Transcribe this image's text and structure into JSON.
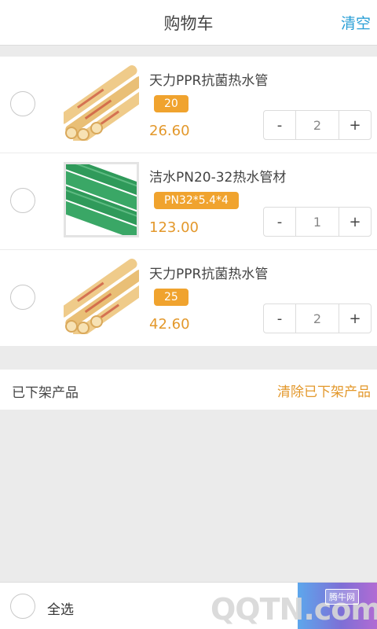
{
  "header": {
    "title": "购物车",
    "clear_label": "清空"
  },
  "items": [
    {
      "name": "天力PPR抗菌热水管",
      "spec": "20",
      "price": "26.60",
      "quantity": "2",
      "minus_label": "-",
      "plus_label": "+",
      "image": "yellow-pipes"
    },
    {
      "name": "洁水PN20-32热水管材",
      "spec": "PN32*5.4*4",
      "price": "123.00",
      "quantity": "1",
      "minus_label": "-",
      "plus_label": "+",
      "image": "green-pipes"
    },
    {
      "name": "天力PPR抗菌热水管",
      "spec": "25",
      "price": "42.60",
      "quantity": "2",
      "minus_label": "-",
      "plus_label": "+",
      "image": "yellow-pipes"
    }
  ],
  "off_shelf": {
    "label": "已下架产品",
    "action_label": "清除已下架产品"
  },
  "footer": {
    "select_all_label": "全选"
  },
  "watermark": {
    "logo": "QQTN.com",
    "badge": "腾牛网"
  },
  "colors": {
    "accent_blue": "#2a9fd6",
    "price_orange": "#e3982b",
    "spec_badge": "#f0a32e"
  }
}
